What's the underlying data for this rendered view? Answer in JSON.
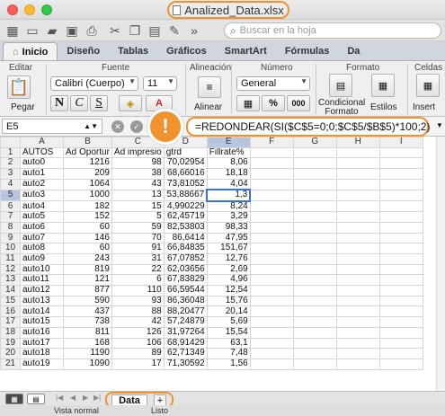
{
  "window": {
    "title": "Analized_Data.xlsx"
  },
  "search": {
    "placeholder": "Buscar en la hoja"
  },
  "tabs": [
    {
      "label": "Inicio"
    },
    {
      "label": "Diseño"
    },
    {
      "label": "Tablas"
    },
    {
      "label": "Gráficos"
    },
    {
      "label": "SmartArt"
    },
    {
      "label": "Fórmulas"
    },
    {
      "label": "Da"
    }
  ],
  "ribbon": {
    "group_edit": "Editar",
    "group_font": "Fuente",
    "group_align": "Alineación",
    "group_number": "Número",
    "group_format": "Formato",
    "group_cells": "Celdas",
    "paste": "Pegar",
    "font_name": "Calibri (Cuerpo)",
    "font_size": "11",
    "bold": "N",
    "italic": "C",
    "underline": "S",
    "align": "Alinear",
    "number_format": "General",
    "percent": "%",
    "thousands": "000",
    "conditional": "Condicional Formato",
    "styles": "Estilos",
    "insert": "Insert"
  },
  "formula_bar": {
    "cell_ref": "E5",
    "formula": "=REDONDEAR(SI($C$5=0;0;$C$5/$B$5)*100;2)"
  },
  "sheet": {
    "columns": [
      "A",
      "B",
      "C",
      "D",
      "E",
      "F",
      "G",
      "H",
      "I"
    ],
    "active_row": 5,
    "rows": [
      [
        "AUTOS",
        "Ad Oportur",
        "Ad impresio",
        "gtrd",
        "Fillrate%"
      ],
      [
        "auto0",
        "1216",
        "98",
        "70,02954",
        "8,06"
      ],
      [
        "auto1",
        "209",
        "38",
        "68,66016",
        "18,18"
      ],
      [
        "auto2",
        "1064",
        "43",
        "73,81052",
        "4,04"
      ],
      [
        "auto3",
        "1000",
        "13",
        "53,88667",
        "1,3"
      ],
      [
        "auto4",
        "182",
        "15",
        "4,990229",
        "8,24"
      ],
      [
        "auto5",
        "152",
        "5",
        "62,45719",
        "3,29"
      ],
      [
        "auto6",
        "60",
        "59",
        "82,53803",
        "98,33"
      ],
      [
        "auto7",
        "146",
        "70",
        "86,6414",
        "47,95"
      ],
      [
        "auto8",
        "60",
        "91",
        "66,84835",
        "151,67"
      ],
      [
        "auto9",
        "243",
        "31",
        "67,07852",
        "12,76"
      ],
      [
        "auto10",
        "819",
        "22",
        "62,03656",
        "2,69"
      ],
      [
        "auto11",
        "121",
        "6",
        "67,83829",
        "4,96"
      ],
      [
        "auto12",
        "877",
        "110",
        "66,59544",
        "12,54"
      ],
      [
        "auto13",
        "590",
        "93",
        "86,36048",
        "15,76"
      ],
      [
        "auto14",
        "437",
        "88",
        "88,20477",
        "20,14"
      ],
      [
        "auto15",
        "738",
        "42",
        "57,24879",
        "5,69"
      ],
      [
        "auto16",
        "811",
        "126",
        "31,97264",
        "15,54"
      ],
      [
        "auto17",
        "168",
        "106",
        "68,91429",
        "63,1"
      ],
      [
        "auto18",
        "1190",
        "89",
        "62,71349",
        "7,48"
      ],
      [
        "auto19",
        "1090",
        "17",
        "71,30592",
        "1,56"
      ]
    ]
  },
  "sheet_tabs": [
    {
      "label": "Data"
    }
  ],
  "add_sheet": "+",
  "status": {
    "view": "Vista normal",
    "state": "Listo"
  }
}
